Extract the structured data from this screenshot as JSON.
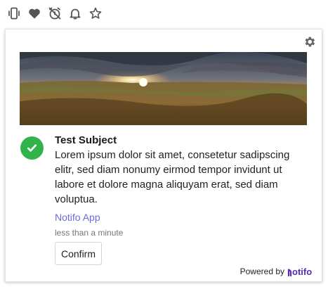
{
  "toolbar": {
    "icons": [
      "mobile-vibrate-icon",
      "heart-icon",
      "alarm-off-icon",
      "bell-icon",
      "star-icon"
    ]
  },
  "notification": {
    "subject": "Test Subject",
    "body": "Lorem ipsum dolor sit amet, consetetur sadipscing elitr, sed diam nonumy eirmod tempor invidunt ut labore et dolore magna aliquyam erat, sed diam voluptua.",
    "app_name": "Notifo App",
    "time": "less than a minute",
    "confirm_label": "Confirm"
  },
  "footer": {
    "powered_by": "Powered by",
    "brand": "notifo"
  },
  "colors": {
    "check": "#2fb34a",
    "link": "#6d6ad8",
    "brand": "#5a2bb5"
  }
}
